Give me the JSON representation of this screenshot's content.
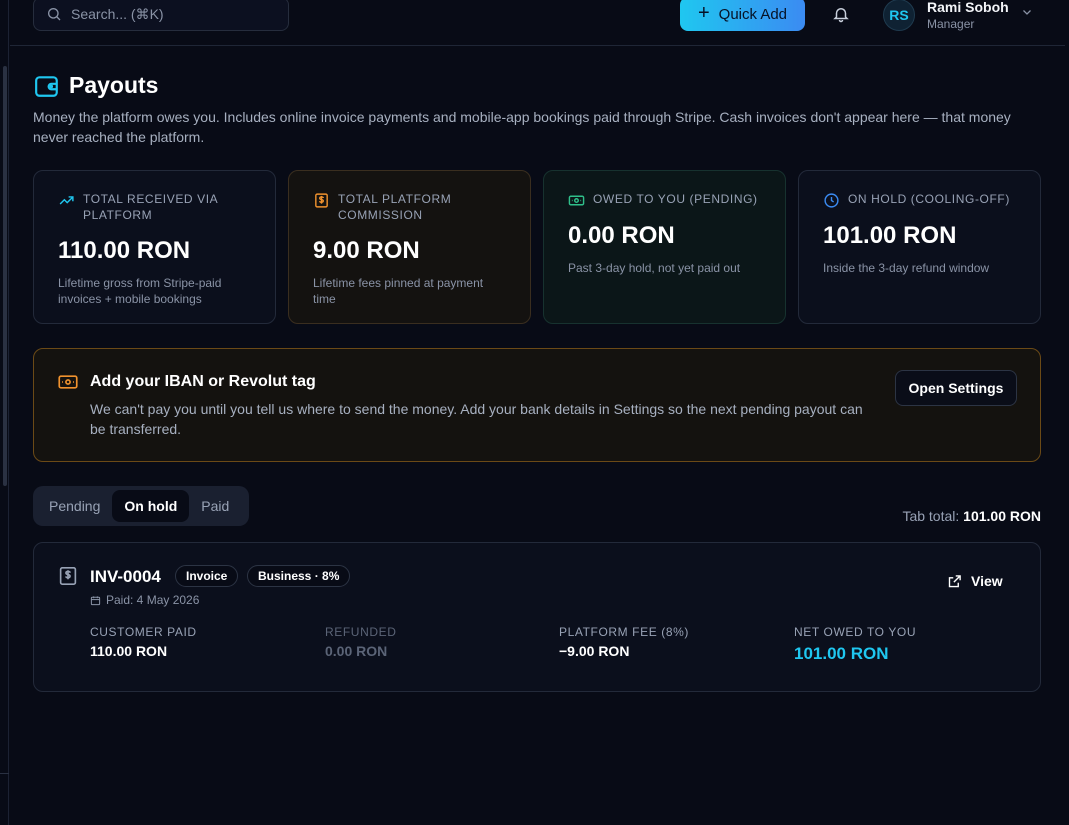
{
  "topbar": {
    "search_placeholder": "Search... (⌘K)",
    "quick_add_label": "Quick Add",
    "user": {
      "initials": "RS",
      "name": "Rami Soboh",
      "role": "Manager"
    }
  },
  "page": {
    "title": "Payouts",
    "description": "Money the platform owes you. Includes online invoice payments and mobile-app bookings paid through Stripe. Cash invoices don't appear here — that money never reached the platform."
  },
  "stats": [
    {
      "label": "TOTAL RECEIVED VIA PLATFORM",
      "value": "110.00 RON",
      "sub": "Lifetime gross from Stripe-paid invoices + mobile bookings",
      "icon": "trending-up-icon",
      "color": "#1fc7f0"
    },
    {
      "label": "TOTAL PLATFORM COMMISSION",
      "value": "9.00 RON",
      "sub": "Lifetime fees pinned at payment time",
      "icon": "dollar-receipt-icon",
      "color": "#f0922e"
    },
    {
      "label": "OWED TO YOU (PENDING)",
      "value": "0.00 RON",
      "sub": "Past 3-day hold, not yet paid out",
      "icon": "banknote-icon",
      "color": "#2fbf8a"
    },
    {
      "label": "ON HOLD (COOLING-OFF)",
      "value": "101.00 RON",
      "sub": "Inside the 3-day refund window",
      "icon": "clock-icon",
      "color": "#3b8bf2"
    }
  ],
  "banner": {
    "title": "Add your IBAN or Revolut tag",
    "text": "We can't pay you until you tell us where to send the money. Add your bank details in Settings so the next pending payout can be transferred.",
    "button_label": "Open Settings"
  },
  "tabs": {
    "items": [
      "Pending",
      "On hold",
      "Paid"
    ],
    "active": "On hold",
    "total_label": "Tab total:",
    "total_value": "101.00 RON"
  },
  "payouts": [
    {
      "invoice": "INV-0004",
      "badges": [
        "Invoice",
        "Business · 8%"
      ],
      "paid_date": "Paid: 4 May 2026",
      "view_label": "View",
      "metrics": [
        {
          "label": "CUSTOMER PAID",
          "value": "110.00 RON"
        },
        {
          "label": "REFUNDED",
          "value": "0.00 RON"
        },
        {
          "label": "PLATFORM FEE (8%)",
          "value": "−9.00 RON"
        },
        {
          "label": "NET OWED TO YOU",
          "value": "101.00 RON"
        }
      ]
    }
  ]
}
